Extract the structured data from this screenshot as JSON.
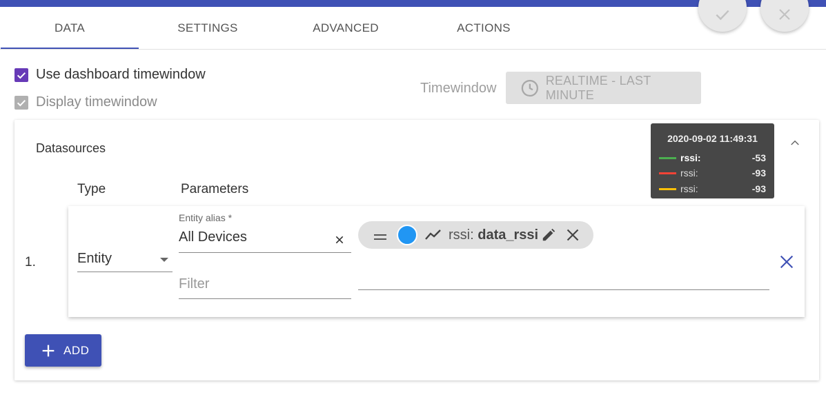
{
  "tabs": [
    "DATA",
    "SETTINGS",
    "ADVANCED",
    "ACTIONS"
  ],
  "accent_color": "#3f51b5",
  "checkbox_color": "#673ab7",
  "use_dashboard_timewindow": {
    "label": "Use dashboard timewindow",
    "checked": true
  },
  "display_timewindow": {
    "label": "Display timewindow",
    "checked": true,
    "disabled": true
  },
  "timewindow": {
    "label": "Timewindow",
    "value": "REALTIME - LAST MINUTE",
    "icon": "clock-icon"
  },
  "datasources": {
    "title": "Datasources",
    "col_type": "Type",
    "col_parameters": "Parameters",
    "rows": [
      {
        "index": "1.",
        "type": "Entity",
        "entity_alias_label": "Entity alias *",
        "entity_alias_value": "All Devices",
        "filter_placeholder": "Filter",
        "chip": {
          "key": "rssi:",
          "value": "data_rssi",
          "color": "#2196f3"
        }
      }
    ],
    "add_label": "ADD"
  },
  "tooltip": {
    "time": "2020-09-02 11:49:31",
    "rows": [
      {
        "key": "rssi:",
        "value": "-53",
        "color": "#4caf50",
        "bold": true
      },
      {
        "key": "rssi:",
        "value": "-93",
        "color": "#f44336",
        "bold": false
      },
      {
        "key": "rssi:",
        "value": "-93",
        "color": "#ffc107",
        "bold": false
      }
    ]
  }
}
